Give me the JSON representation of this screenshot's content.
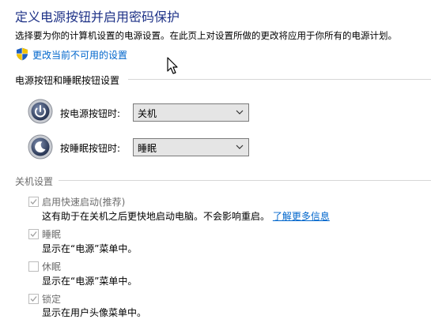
{
  "header": {
    "title": "定义电源按钮并启用密码保护",
    "description": "选择要为你的计算机设置的电源设置。在此页上对设置所做的更改将应用于你所有的电源计划。",
    "change_link": "更改当前不可用的设置",
    "shield_icon": "uac-shield-icon"
  },
  "buttons_section": {
    "title": "电源按钮和睡眠按钮设置",
    "rows": [
      {
        "label": "按电源按钮时:",
        "value": "关机",
        "icon": "power-button-icon"
      },
      {
        "label": "按睡眠按钮时:",
        "value": "睡眠",
        "icon": "sleep-button-icon"
      }
    ]
  },
  "shutdown_section": {
    "title": "关机设置",
    "options": [
      {
        "label": "启用快速启动(推荐)",
        "checked": true,
        "description": "这有助于在关机之后更快地启动电脑。不会影响重启。",
        "link": "了解更多信息"
      },
      {
        "label": "睡眠",
        "checked": true,
        "description": "显示在“电源”菜单中。"
      },
      {
        "label": "休眠",
        "checked": false,
        "description": "显示在“电源”菜单中。"
      },
      {
        "label": "锁定",
        "checked": true,
        "description": "显示在用户头像菜单中。"
      }
    ]
  },
  "colors": {
    "title": "#1e3287",
    "link": "#0066cc",
    "disabled_text": "#6d6d6d"
  }
}
